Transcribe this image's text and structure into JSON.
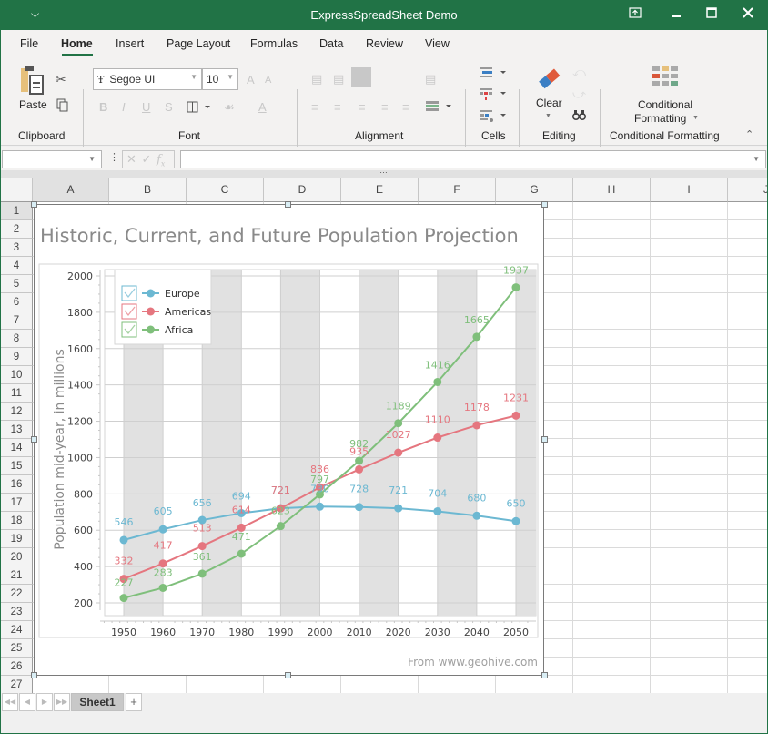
{
  "window": {
    "title": "ExpressSpreadSheet Demo",
    "qat_icon": "customize-quick-access-icon",
    "buttons": [
      "restore-ribbon-icon",
      "minimize-icon",
      "maximize-icon",
      "close-icon"
    ]
  },
  "ribbon": {
    "tabs": [
      {
        "label": "File"
      },
      {
        "label": "Home",
        "active": true
      },
      {
        "label": "Insert"
      },
      {
        "label": "Page Layout"
      },
      {
        "label": "Formulas"
      },
      {
        "label": "Data"
      },
      {
        "label": "Review"
      },
      {
        "label": "View"
      }
    ],
    "clipboard": {
      "label": "Clipboard",
      "paste": "Paste"
    },
    "font": {
      "label": "Font",
      "font_name": "Segoe UI",
      "font_size": "10"
    },
    "alignment": {
      "label": "Alignment"
    },
    "cells": {
      "label": "Cells"
    },
    "editing": {
      "label": "Editing",
      "clear": "Clear"
    },
    "conditional": {
      "label": "Conditional Formatting",
      "button_line1": "Conditional",
      "button_line2": "Formatting"
    }
  },
  "formula_bar": {
    "name_box": "",
    "formula": ""
  },
  "grid": {
    "columns": [
      "A",
      "B",
      "C",
      "D",
      "E",
      "F",
      "G",
      "H",
      "I",
      "J"
    ],
    "rows": [
      "1",
      "2",
      "3",
      "4",
      "5",
      "6",
      "7",
      "8",
      "9",
      "10",
      "11",
      "12",
      "13",
      "14",
      "15",
      "16",
      "17",
      "18",
      "19",
      "20",
      "21",
      "22",
      "23",
      "24",
      "25",
      "26",
      "27"
    ],
    "selected_column": "A",
    "selected_row": "1"
  },
  "sheets": {
    "tabs": [
      "Sheet1"
    ],
    "active": "Sheet1",
    "add_label": "+"
  },
  "chart_data": {
    "type": "line",
    "title": "Historic, Current, and Future Population Projection",
    "xlabel": "",
    "ylabel": "Population mid-year, in millions",
    "source": "From www.geohive.com",
    "x": [
      1950,
      1960,
      1970,
      1980,
      1990,
      2000,
      2010,
      2020,
      2030,
      2040,
      2050
    ],
    "ylim": [
      200,
      2000
    ],
    "yticks": [
      200,
      400,
      600,
      800,
      1000,
      1200,
      1400,
      1600,
      1800,
      2000
    ],
    "legend_position": "top-left",
    "grid": true,
    "series": [
      {
        "name": "Europe",
        "color": "#6cb8d2",
        "values": [
          546,
          605,
          656,
          694,
          721,
          730,
          728,
          721,
          704,
          680,
          650
        ]
      },
      {
        "name": "Americas",
        "color": "#e5767f",
        "values": [
          332,
          417,
          513,
          614,
          721,
          836,
          935,
          1027,
          1110,
          1178,
          1231
        ]
      },
      {
        "name": "Africa",
        "color": "#7fbf7b",
        "values": [
          227,
          283,
          361,
          471,
          623,
          797,
          982,
          1189,
          1416,
          1665,
          1937
        ]
      }
    ]
  }
}
